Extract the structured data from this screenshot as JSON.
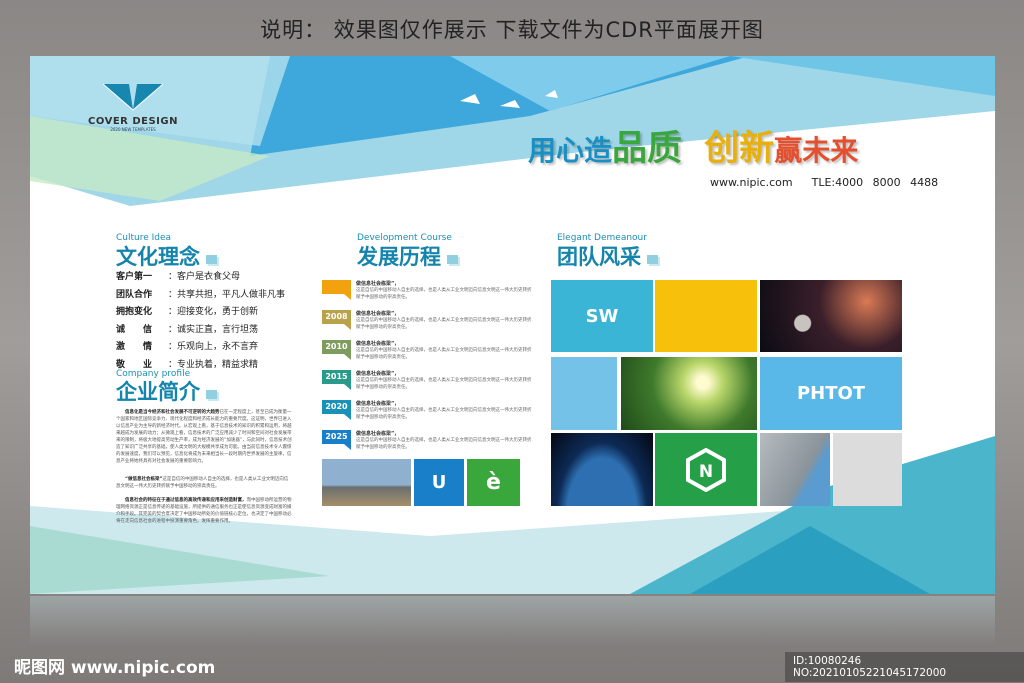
{
  "caption": "说明： 效果图仅作展示  下载文件为CDR平面展开图",
  "logo": {
    "title": "COVER DESIGN",
    "subtitle": "2020 NEW TEMPLATES"
  },
  "slogan": {
    "p1": "用心造",
    "p2": "品质",
    "p3": "创新",
    "p4": "赢未来"
  },
  "contact": {
    "url": "www.nipic.com",
    "tel": "TLE:4000 8000 4488"
  },
  "culture": {
    "en": "Culture Idea",
    "zh": "文化理念",
    "rows": [
      {
        "k": "客户第一",
        "v": "：客户是衣食父母"
      },
      {
        "k": "团队合作",
        "v": "：共享共担，平凡人做非凡事"
      },
      {
        "k": "拥抱变化",
        "v": "：迎接变化，勇于创新"
      },
      {
        "k": "诚　　信",
        "v": "：诚实正直，言行坦荡"
      },
      {
        "k": "激　　情",
        "v": "：乐观向上，永不言弃"
      },
      {
        "k": "敬　　业",
        "v": "：专业执着，精益求精"
      }
    ]
  },
  "profile": {
    "en": "Company profile",
    "zh": "企业简介",
    "p1b": "信息化是当今经济和社会发展不可逆转的大趋势",
    "p1": "已在一定程度上，甚至已成为衡量一个国家和地区国际竞争力、现代化程度和经济成长能力的重要尺度。这证明，世界已进入以信息产业为主导的新经济时代。从宏观上看，基于信息技术的知识的积累和运用，将越来越成为发展的动力；从微观上看，信息技术的广泛应用减少了时间和空间对社会发展带来的限制，将极大地提高劳动生产率，成为经济发展的“加速器”，与此同时，信息技术创造了知识广泛共享的基础，使人类文明的大规模共享成为可能。由当前信息技术令人震惊的发展速度，我们可以预见，信息化将成为未来相当长一段时期内世界发展的主旋律，信息产业将始终具有对社会发展的重要影响力。",
    "p2b": "“做信息社会栋梁”",
    "p2": "这是自信的中国移动人自主的选择，也是人类从工业文明迈向信息文明这一伟大历史转折赋予中国移动的崇高责任。",
    "p3b": "信息社会的特征在于通过信息的高效传递和应用来创造财富，",
    "p3": "而中国移动所运营的物理网络资源正是信息传递的基础设施，所提供的通信服务也正是使信息资源变成财富的媒介和手段。其完美的契合度决定了中国移动所处的价值链核心定位，也决定了中国移动必将在走向信息社会的进程中扮演重要角色，发挥重要作用。"
  },
  "course": {
    "en": "Development Course",
    "zh": "发展历程",
    "item_title": "做信息社会栋梁”，",
    "item_text": "这是自信的中国移动人自主的选择，也是人类从工业文明迈向信息文明这一伟大历史转折赋予中国移动的崇高责任。",
    "years": [
      "",
      "2008",
      "2010",
      "2015",
      "2020",
      "2025"
    ],
    "colors": [
      "#f2a20f",
      "#b9a24a",
      "#7f9c5f",
      "#2a9a8a",
      "#1a92b8",
      "#1a7fc9"
    ]
  },
  "course_tiles": {
    "u": "U",
    "e": "è"
  },
  "team": {
    "en": "Elegant Demeanour",
    "zh": "团队风采",
    "sw": "SW",
    "phtot": "PHTOT"
  },
  "footer": {
    "brand": "昵图网",
    "url": "www.nipic.com",
    "id": "ID:10080246 NO:20210105221045172000"
  }
}
